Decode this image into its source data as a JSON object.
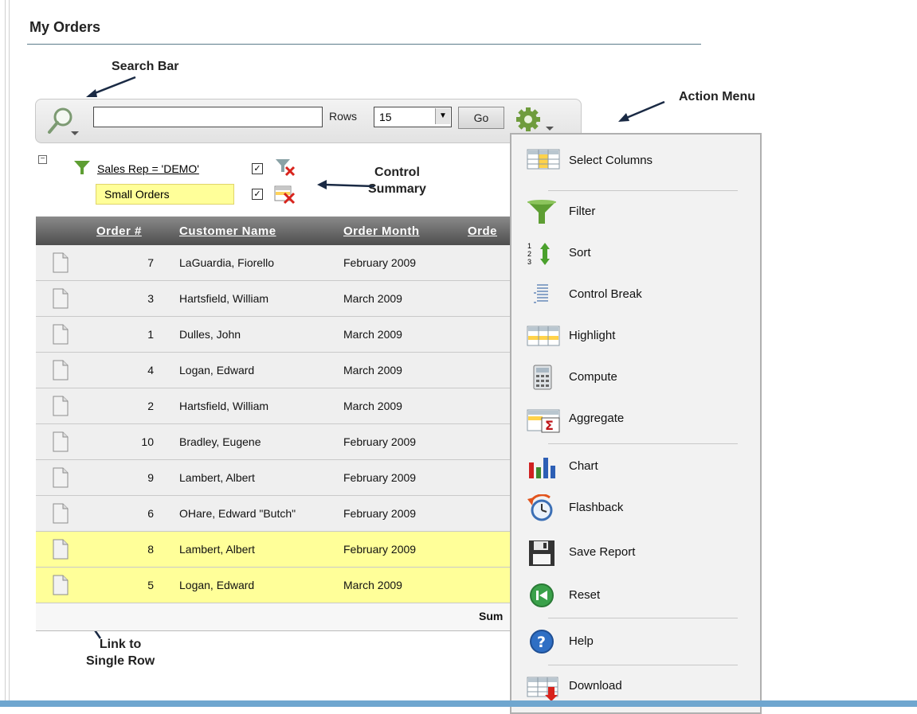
{
  "page_title": "My Orders",
  "annotations": {
    "search_bar": "Search Bar",
    "action_menu": "Action Menu",
    "control_summary": "Control\nSummary",
    "link_row": "Link to\nSingle Row"
  },
  "search": {
    "value": "",
    "rows_label": "Rows",
    "rows_value": "15",
    "go_label": "Go"
  },
  "controls": {
    "filter_label": "Sales Rep = 'DEMO'",
    "highlight_label": "Small Orders"
  },
  "grid": {
    "headers": [
      "Order #",
      "Customer Name",
      "Order Month",
      "Orde"
    ],
    "rows": [
      {
        "num": "7",
        "customer": "LaGuardia, Fiorello",
        "month": "February 2009",
        "highlight": false
      },
      {
        "num": "3",
        "customer": "Hartsfield, William",
        "month": "March 2009",
        "highlight": false
      },
      {
        "num": "1",
        "customer": "Dulles, John",
        "month": "March 2009",
        "highlight": false
      },
      {
        "num": "4",
        "customer": "Logan, Edward",
        "month": "March 2009",
        "highlight": false
      },
      {
        "num": "2",
        "customer": "Hartsfield, William",
        "month": "March 2009",
        "highlight": false
      },
      {
        "num": "10",
        "customer": "Bradley, Eugene",
        "month": "February 2009",
        "highlight": false
      },
      {
        "num": "9",
        "customer": "Lambert, Albert",
        "month": "February 2009",
        "highlight": false
      },
      {
        "num": "6",
        "customer": "OHare, Edward \"Butch\"",
        "month": "February 2009",
        "highlight": false
      },
      {
        "num": "8",
        "customer": "Lambert, Albert",
        "month": "February 2009",
        "highlight": true
      },
      {
        "num": "5",
        "customer": "Logan, Edward",
        "month": "March 2009",
        "highlight": true
      }
    ],
    "sum_label": "Sum"
  },
  "menu": {
    "items": [
      {
        "label": "Select Columns",
        "icon": "select-columns-icon"
      },
      {
        "label": "Filter",
        "icon": "filter-icon"
      },
      {
        "label": "Sort",
        "icon": "sort-icon"
      },
      {
        "label": "Control Break",
        "icon": "control-break-icon"
      },
      {
        "label": "Highlight",
        "icon": "highlight-icon"
      },
      {
        "label": "Compute",
        "icon": "calculator-icon"
      },
      {
        "label": "Aggregate",
        "icon": "sigma-icon"
      },
      {
        "label": "Chart",
        "icon": "bar-chart-icon"
      },
      {
        "label": "Flashback",
        "icon": "flashback-icon"
      },
      {
        "label": "Save Report",
        "icon": "floppy-disk-icon"
      },
      {
        "label": "Reset",
        "icon": "reset-icon"
      },
      {
        "label": "Help",
        "icon": "help-icon"
      },
      {
        "label": "Download",
        "icon": "download-icon"
      }
    ]
  },
  "colors": {
    "highlight": "#ffff99",
    "header_dark": "#4e4e4e",
    "accent_blue": "#6fa6cf"
  }
}
